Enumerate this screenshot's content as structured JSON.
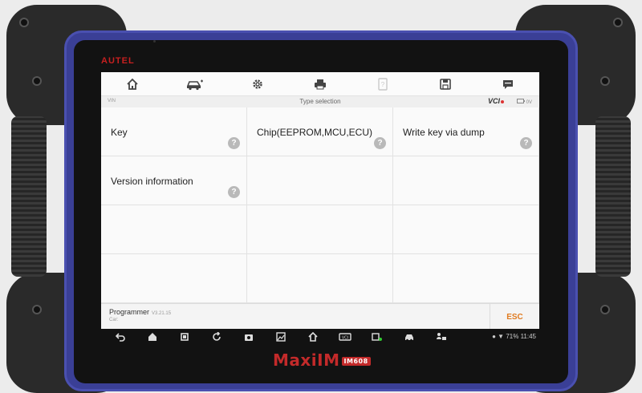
{
  "device": {
    "brand": "AUTEL",
    "model": "MaxiIM",
    "model_badge": "IM608"
  },
  "toolbar": {
    "icons": [
      "home-icon",
      "vehicle-icon",
      "settings-icon",
      "print-icon",
      "help-icon",
      "save-icon",
      "feedback-icon"
    ]
  },
  "status": {
    "vin_label": "VIN",
    "title": "Type selection",
    "vci_label": "VCI",
    "voltage": "0V"
  },
  "menu": {
    "items": [
      {
        "label": "Key",
        "help": "?"
      },
      {
        "label": "Chip(EEPROM,MCU,ECU)",
        "help": "?"
      },
      {
        "label": "Write key via dump",
        "help": "?"
      },
      {
        "label": "Version information",
        "help": "?"
      }
    ]
  },
  "footer": {
    "app_name": "Programmer",
    "version": "V3.21.15",
    "car_label": "Car:",
    "esc_label": "ESC"
  },
  "system": {
    "status_text": "71% 11:45"
  },
  "colors": {
    "brand_red": "#c62020",
    "frame_blue": "#3a3f96",
    "esc_orange": "#e07b20"
  }
}
